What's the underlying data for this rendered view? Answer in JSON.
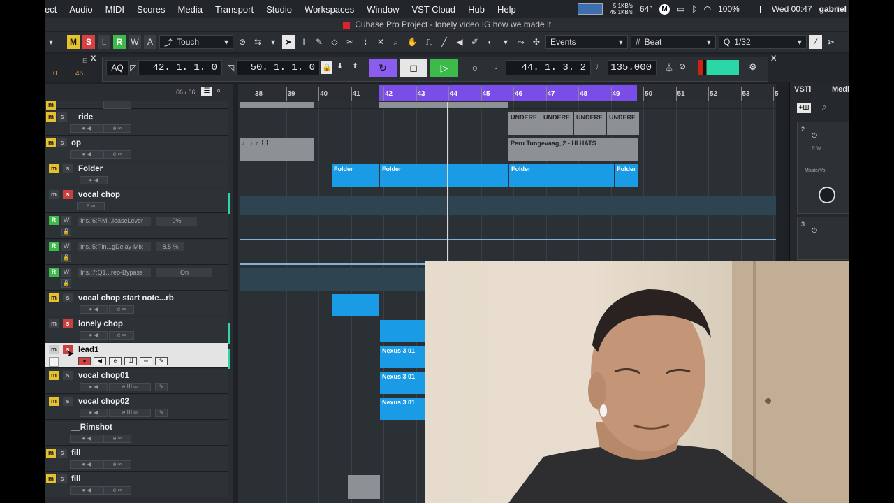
{
  "menubar": {
    "items": [
      "ect",
      "Audio",
      "MIDI",
      "Scores",
      "Media",
      "Transport",
      "Studio",
      "Workspaces",
      "Window",
      "VST Cloud",
      "Hub",
      "Help"
    ],
    "net_up": "5.1KB/s",
    "net_down": "45.1KB/s",
    "temp": "64°",
    "battery": "100%",
    "clock": "Wed 00:47",
    "user": "gabriel"
  },
  "title": "Cubase Pro Project - lonely video IG how we made it",
  "toolbar": {
    "btn_m": "M",
    "btn_s": "S",
    "btn_l": "L",
    "btn_r": "R",
    "btn_w": "W",
    "btn_a": "A",
    "automation_mode": "Touch",
    "events_mode": "Events",
    "snap_type": "Beat",
    "quantize": "1/32"
  },
  "transport": {
    "left_val1": "E",
    "left_val2": "0",
    "left_val3": "46.",
    "aq": "AQ",
    "left_locator": "42. 1. 1.   0",
    "right_locator": "50. 1. 1.   0",
    "position": "44. 1. 3.   2",
    "tempo": "135.000"
  },
  "tracklist": {
    "count": "66 / 66",
    "tracks": [
      {
        "name": "ride",
        "type": "audio"
      },
      {
        "name": "op",
        "type": "audio"
      },
      {
        "name": "Folder",
        "type": "folder"
      },
      {
        "name": "vocal chop",
        "type": "audio",
        "solo": true
      },
      {
        "name": "",
        "type": "auto",
        "param": "Ins.:6:RM...leaseLever",
        "value": "0%"
      },
      {
        "name": "",
        "type": "auto",
        "param": "Ins.:5:Pin...gDelay-Mix",
        "value": "8.5 %"
      },
      {
        "name": "",
        "type": "auto",
        "param": "Ins.:7:Q1...reo-Bypass",
        "value": "On"
      },
      {
        "name": "vocal chop start note...rb",
        "type": "audio"
      },
      {
        "name": "lonely chop",
        "type": "audio",
        "solo": true
      },
      {
        "name": "lead1",
        "type": "instrument",
        "selected": true
      },
      {
        "name": "vocal chop01",
        "type": "instrument"
      },
      {
        "name": "vocal chop02",
        "type": "instrument"
      },
      {
        "name": "__Rimshot",
        "type": "audio"
      },
      {
        "name": "fill",
        "type": "audio"
      },
      {
        "name": "fill",
        "type": "audio"
      }
    ]
  },
  "ruler": {
    "bars": [
      "38",
      "39",
      "40",
      "41",
      "42",
      "43",
      "44",
      "45",
      "46",
      "47",
      "48",
      "49",
      "50",
      "51",
      "52",
      "53",
      "5"
    ]
  },
  "events": {
    "ride_label": "UNDERF",
    "op_label": "Peru Tungevaag_2 - HI HATS",
    "folder_label": "Folder",
    "nexus_label": "Nexus 3 01"
  },
  "rightpanel": {
    "tab_vsti": "VSTi",
    "tab_media": "Medi",
    "slot1": "2",
    "slot2": "3",
    "mastervol": "MasterVol",
    "rw": "R W"
  },
  "colors": {
    "loop": "#7b4de8",
    "event_blue": "#1a9be6",
    "meter": "#2bd6a7",
    "mute": "#e5c12f",
    "solo": "#c94040",
    "play": "#3dbb4a"
  }
}
